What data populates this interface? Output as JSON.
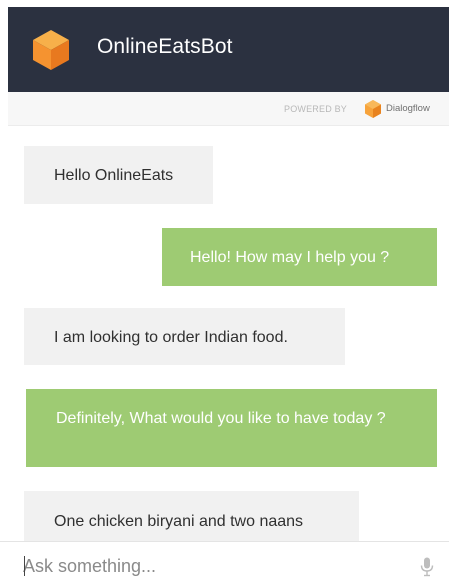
{
  "header": {
    "bot_name": "OnlineEatsBot",
    "logo_icon": "cube-icon",
    "background_color": "#2b3140",
    "logo_color": "#f5a03b"
  },
  "powered_by": {
    "label": "POWERED BY",
    "brand": "Dialogflow",
    "brand_icon": "dialogflow-icon"
  },
  "messages": [
    {
      "sender": "user",
      "text": "Hello OnlineEats"
    },
    {
      "sender": "bot",
      "text": "Hello! How may I help you ?"
    },
    {
      "sender": "user",
      "text": "I am looking to order Indian food."
    },
    {
      "sender": "bot",
      "text": "Definitely, What would you like to have today ?"
    },
    {
      "sender": "user",
      "text": "One chicken biryani and two naans"
    }
  ],
  "colors": {
    "user_bubble": "#f1f1f1",
    "bot_bubble": "#9ecb73"
  },
  "input": {
    "placeholder": "Ask something...",
    "value": "",
    "mic_icon": "microphone-icon"
  }
}
